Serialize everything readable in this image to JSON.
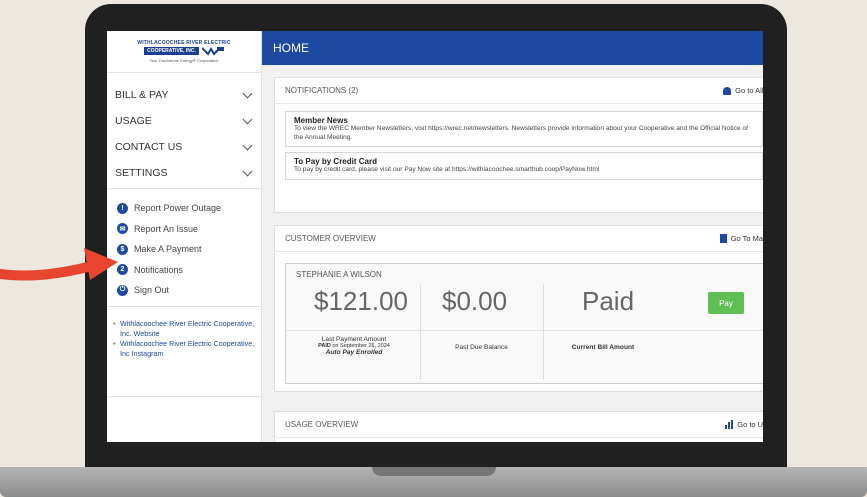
{
  "brand": {
    "logo_line1": "WITHLACOOCHEE RIVER ELECTRIC",
    "logo_line2": "COOPERATIVE, INC.",
    "tagline": "Your Touchstone Energy® Cooperative",
    "primary": "#1d4aa0",
    "accent": "#e8452e"
  },
  "header": {
    "title": "HOME"
  },
  "sidebar": {
    "menu": [
      {
        "label": "BILL & PAY"
      },
      {
        "label": "USAGE"
      },
      {
        "label": "CONTACT US"
      },
      {
        "label": "SETTINGS"
      }
    ],
    "quick": [
      {
        "label": "Report Power Outage",
        "icon": "!"
      },
      {
        "label": "Report An Issue",
        "icon": "✉"
      },
      {
        "label": "Make A Payment",
        "icon": "$"
      },
      {
        "label": "Notifications",
        "icon": "2"
      },
      {
        "label": "Sign Out",
        "icon": "⏻"
      }
    ],
    "links": [
      "Withlacoochee River Electric Cooperative, Inc. Website",
      "Withlacoochee River Electric Cooperative, Inc Instagram"
    ]
  },
  "notifications": {
    "title": "NOTIFICATIONS (2)",
    "link": "Go to All N",
    "items": [
      {
        "title": "Member News",
        "text": "To view the WREC Member Newsletters, visit https://wrec.net/newsletters. Newsletters provide information about your Cooperative and the Official Notice of the Annual Meeting."
      },
      {
        "title": "To Pay by Credit Card",
        "text": "To pay by credit card, please visit our Pay Now site at https://withlacoochee.smarthub.coop/PayNow.html"
      }
    ]
  },
  "customer": {
    "title": "CUSTOMER OVERVIEW",
    "link": "Go To Make",
    "name": "STEPHANIE A WILSON",
    "last_payment": "$121.00",
    "last_payment_label": "Last Payment Amount",
    "paid_prefix": "PAID",
    "paid_date": "on September 26, 2024",
    "autopay": "Auto Pay Enrolled",
    "past_due": "$0.00",
    "past_due_label": "Past Due Balance",
    "status": "Paid",
    "status_label": "Current Bill Amount",
    "pay_button": "Pay"
  },
  "usage": {
    "title": "USAGE OVERVIEW",
    "link": "Go to Usa"
  }
}
